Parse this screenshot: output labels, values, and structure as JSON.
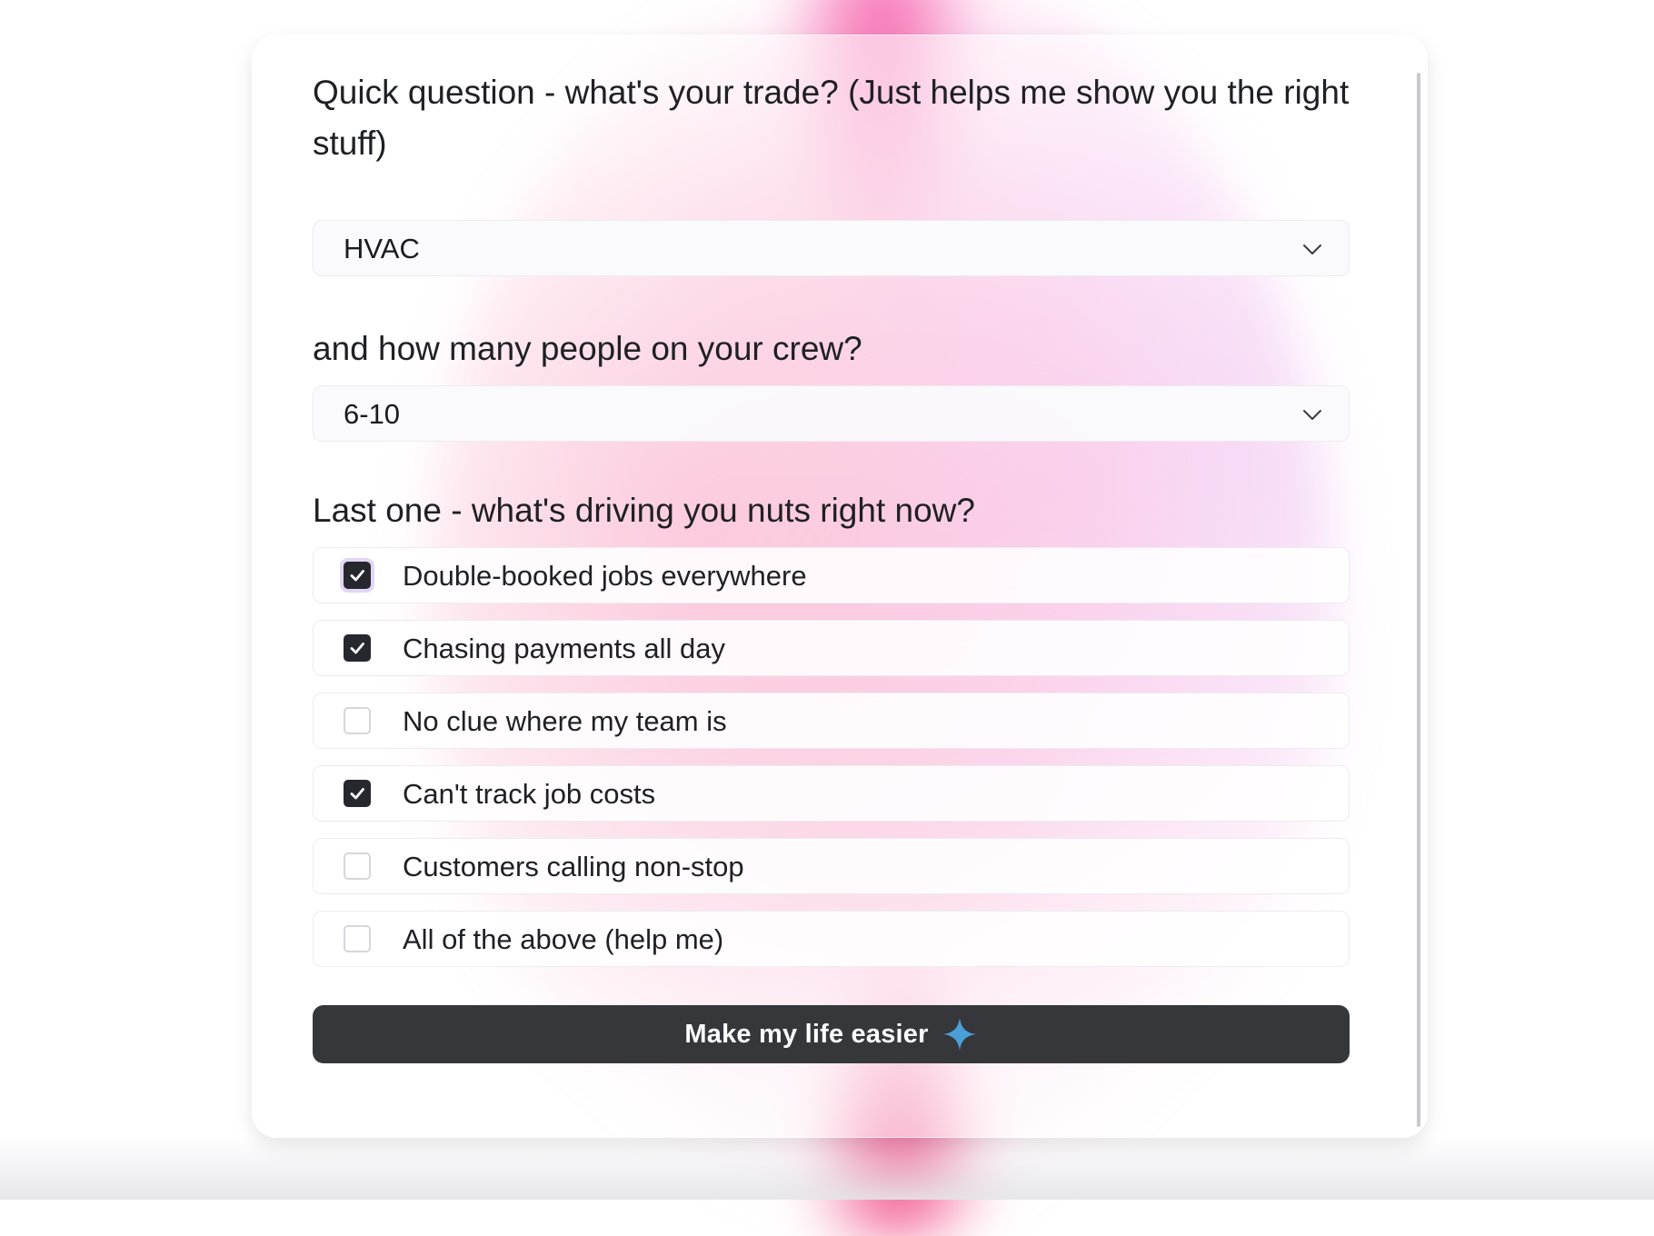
{
  "questions": {
    "trade": "Quick question - what's your trade? (Just helps me show you the right stuff)",
    "crew": "and how many people on your crew?",
    "pain": "Last one - what's driving you nuts right now?"
  },
  "selects": {
    "trade": {
      "value": "HVAC",
      "icon": "chevron-down-icon"
    },
    "crew": {
      "value": "6-10",
      "icon": "chevron-down-icon"
    }
  },
  "options": [
    {
      "label": "Double-booked jobs everywhere",
      "checked": true,
      "focused": true
    },
    {
      "label": "Chasing payments all day",
      "checked": true,
      "focused": false
    },
    {
      "label": "No clue where my team is",
      "checked": false,
      "focused": false
    },
    {
      "label": "Can't track job costs",
      "checked": true,
      "focused": false
    },
    {
      "label": "Customers calling non-stop",
      "checked": false,
      "focused": false
    },
    {
      "label": "All of the above (help me)",
      "checked": false,
      "focused": false
    }
  ],
  "cta": {
    "label": "Make my life easier",
    "icon": "sparkle-icon"
  },
  "colors": {
    "button_bg": "#36373b",
    "checkbox_checked": "#27282d",
    "sparkle": "#4a9fd8",
    "focus_ring": "#e2d6f7"
  }
}
